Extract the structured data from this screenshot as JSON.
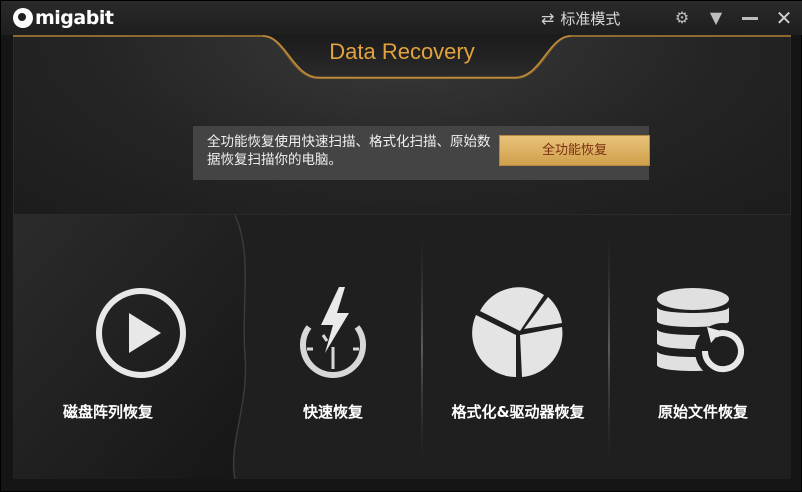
{
  "titlebar": {
    "logo_text": "migabit",
    "mode_label": "标准模式"
  },
  "tab": {
    "title": "Data Recovery"
  },
  "info": {
    "description": "全功能恢复使用快速扫描、格式化扫描、原始数据恢复扫描你的电脑。",
    "button_label": "全功能恢复"
  },
  "features": [
    {
      "label": "磁盘阵列恢复",
      "icon": "play-circle-icon"
    },
    {
      "label": "快速恢复",
      "icon": "lightning-stopwatch-icon"
    },
    {
      "label": "格式化&驱动器恢复",
      "icon": "pie-chart-icon"
    },
    {
      "label": "原始文件恢复",
      "icon": "database-restore-icon"
    }
  ],
  "colors": {
    "accent_gold": "#e2a23e",
    "button_gold": "#d8ae5e",
    "button_text": "#7a2d10"
  }
}
